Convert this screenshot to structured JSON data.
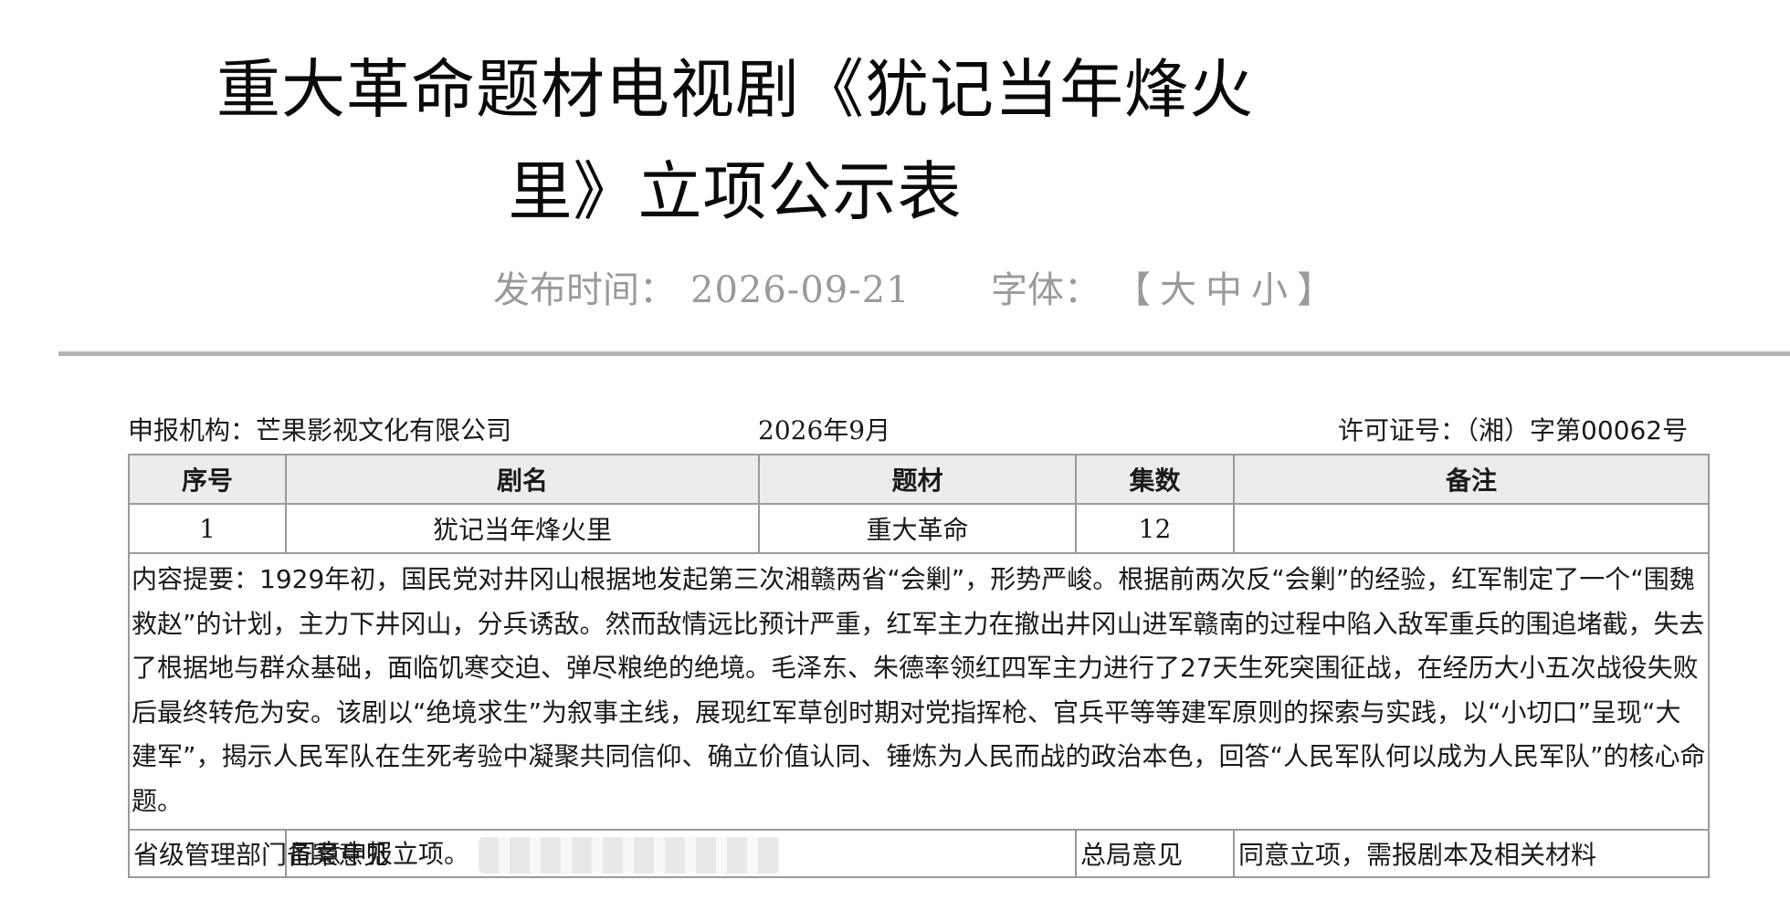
{
  "document": {
    "title_line1": "重大革命题材电视剧《犹记当年烽火",
    "title_line2": "里》立项公示表",
    "publish_label": "发布时间：",
    "publish_date": "2026-09-21",
    "font_label": "字体：",
    "font_sizes": "【大中小】"
  },
  "info": {
    "org": "申报机构：芒果影视文化有限公司",
    "month": "2026年9月",
    "license": "许可证号：（湘）字第00062号"
  },
  "table": {
    "headers": [
      "序号",
      "剧名",
      "题材",
      "集数",
      "备注"
    ],
    "row": {
      "index": "1",
      "name": "犹记当年烽火里",
      "genre": "重大革命",
      "episodes": "12",
      "note": ""
    },
    "summary": "内容提要：1929年初，国民党对井冈山根据地发起第三次湘赣两省“会剿”，形势严峻。根据前两次反“会剿”的经验，红军制定了一个“围魏救赵”的计划，主力下井冈山，分兵诱敌。然而敌情远比预计严重，红军主力在撤出井冈山进军赣南的过程中陷入敌军重兵的围追堵截，失去了根据地与群众基础，面临饥寒交迫、弹尽粮绝的绝境。毛泽东、朱德率领红四军主力进行了27天生死突围征战，在经历大小五次战役失败后最终转危为安。该剧以“绝境求生”为叙事主线，展现红军草创时期对党指挥枪、官兵平等等建军原则的探索与实践，以“小切口”呈现“大建军”，揭示人民军队在生死考验中凝聚共同信仰、确立价值认同、锤炼为人民而战的政治本色，回答“人民军队何以成为人民军队”的核心命题。",
    "footer": {
      "provincial_label": "省级管理部门备案意见",
      "provincial_value": "同意申报立项。",
      "bureau_label": "总局意见",
      "bureau_value": "同意立项，需报剧本及相关材料"
    }
  }
}
